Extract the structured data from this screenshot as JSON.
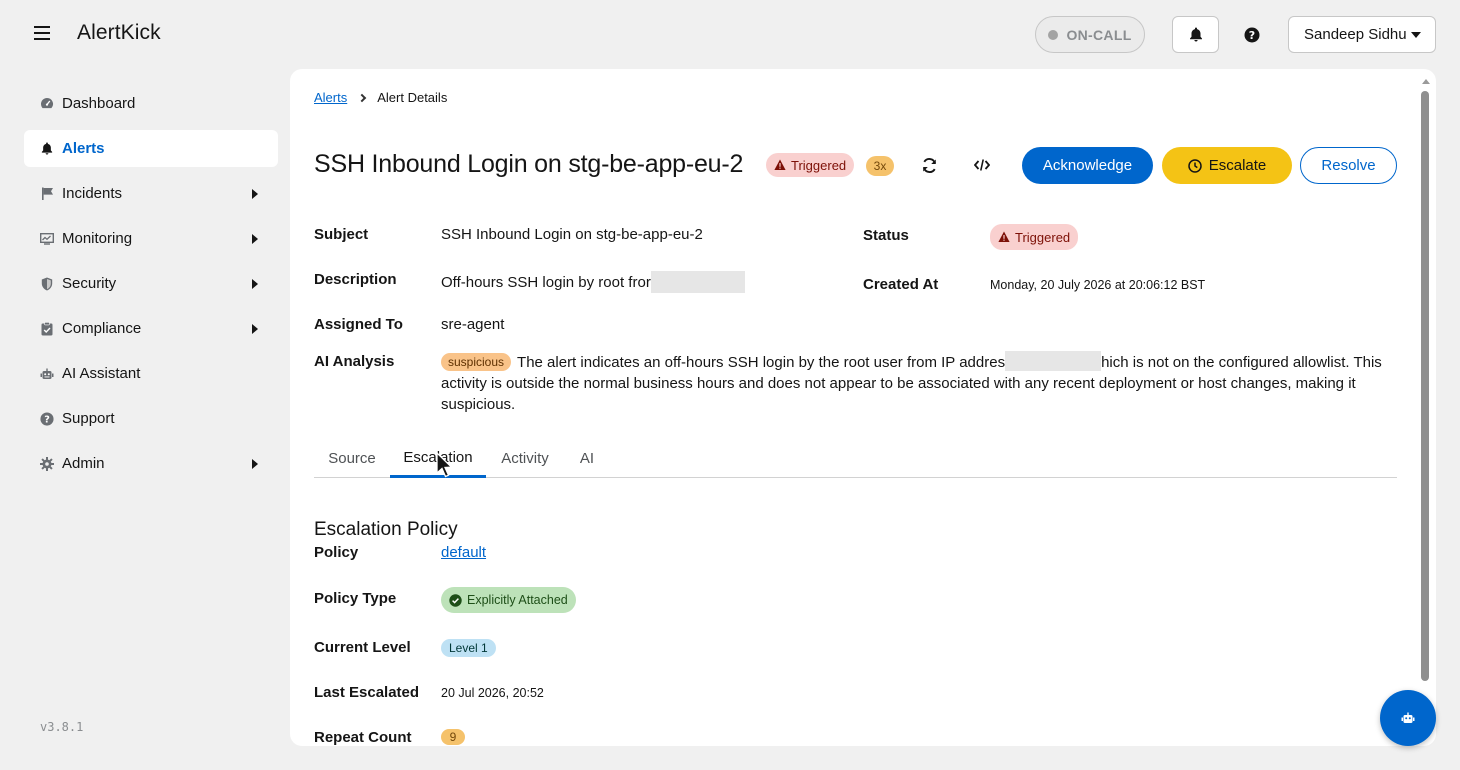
{
  "app": {
    "brand": "AlertKick",
    "oncall_label": "ON-CALL",
    "user_name": "Sandeep Sidhu",
    "version": "v3.8.1"
  },
  "sidebar": {
    "items": [
      {
        "label": "Dashboard",
        "icon": "dashboard-icon",
        "active": false,
        "expandable": false
      },
      {
        "label": "Alerts",
        "icon": "bell-icon",
        "active": true,
        "expandable": false
      },
      {
        "label": "Incidents",
        "icon": "flag-icon",
        "active": false,
        "expandable": true
      },
      {
        "label": "Monitoring",
        "icon": "monitor-icon",
        "active": false,
        "expandable": true
      },
      {
        "label": "Security",
        "icon": "shield-icon",
        "active": false,
        "expandable": true
      },
      {
        "label": "Compliance",
        "icon": "clipboard-check-icon",
        "active": false,
        "expandable": true
      },
      {
        "label": "AI Assistant",
        "icon": "robot-icon",
        "active": false,
        "expandable": false
      },
      {
        "label": "Support",
        "icon": "question-icon",
        "active": false,
        "expandable": false
      },
      {
        "label": "Admin",
        "icon": "gear-icon",
        "active": false,
        "expandable": true
      }
    ]
  },
  "breadcrumb": {
    "parent": "Alerts",
    "current": "Alert Details"
  },
  "alert": {
    "title": "SSH Inbound Login on stg-be-app-eu-2",
    "status_badge": "Triggered",
    "count_badge": "3x",
    "actions": {
      "acknowledge": "Acknowledge",
      "escalate": "Escalate",
      "resolve": "Resolve"
    },
    "fields": {
      "subject_label": "Subject",
      "subject": "SSH Inbound Login on stg-be-app-eu-2",
      "description_label": "Description",
      "description": "Off-hours SSH login by root fror",
      "assigned_label": "Assigned To",
      "assigned": "sre-agent",
      "status_label": "Status",
      "status": "Triggered",
      "created_label": "Created At",
      "created": "Monday, 20 July 2026 at 20:06:12 BST",
      "ai_label": "AI Analysis",
      "ai_tag": "suspicious",
      "ai_text_1": "The alert indicates an off-hours SSH login by the root user from IP addres",
      "ai_text_2": "hich is not on the configured allowlist. This activity is outside the normal business hours and does not appear to be associated with any recent deployment or host changes, making it suspicious."
    }
  },
  "tabs": [
    {
      "label": "Source",
      "active": false
    },
    {
      "label": "Escalation",
      "active": true
    },
    {
      "label": "Activity",
      "active": false
    },
    {
      "label": "AI",
      "active": false
    }
  ],
  "escalation": {
    "section_title": "Escalation Policy",
    "policy_label": "Policy",
    "policy": "default",
    "policy_type_label": "Policy Type",
    "policy_type": "Explicitly Attached",
    "current_level_label": "Current Level",
    "current_level": "Level 1",
    "last_escalated_label": "Last Escalated",
    "last_escalated": "20 Jul 2026, 20:52",
    "repeat_count_label": "Repeat Count",
    "repeat_count": "9"
  },
  "colors": {
    "primary": "#0066cc",
    "warning": "#f4c315",
    "danger_bg": "#f9d0cf",
    "success_bg": "#bde2b9"
  }
}
